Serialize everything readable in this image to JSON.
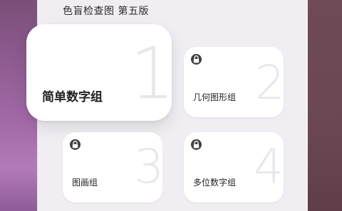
{
  "header": {
    "title": "色盲检查图 第五版"
  },
  "cards": [
    {
      "label": "简单数字组",
      "number": "1",
      "locked": false
    },
    {
      "label": "几何图形组",
      "number": "2",
      "locked": true,
      "icon": "lock-icon"
    },
    {
      "label": "图画组",
      "number": "3",
      "locked": true,
      "icon": "lock-icon"
    },
    {
      "label": "多位数字组",
      "number": "4",
      "locked": true,
      "icon": "lock-icon"
    }
  ],
  "colors": {
    "panel": "#f0eef3",
    "card": "#ffffff",
    "number": "#e8e8eb",
    "lock_badge": "#404040"
  }
}
